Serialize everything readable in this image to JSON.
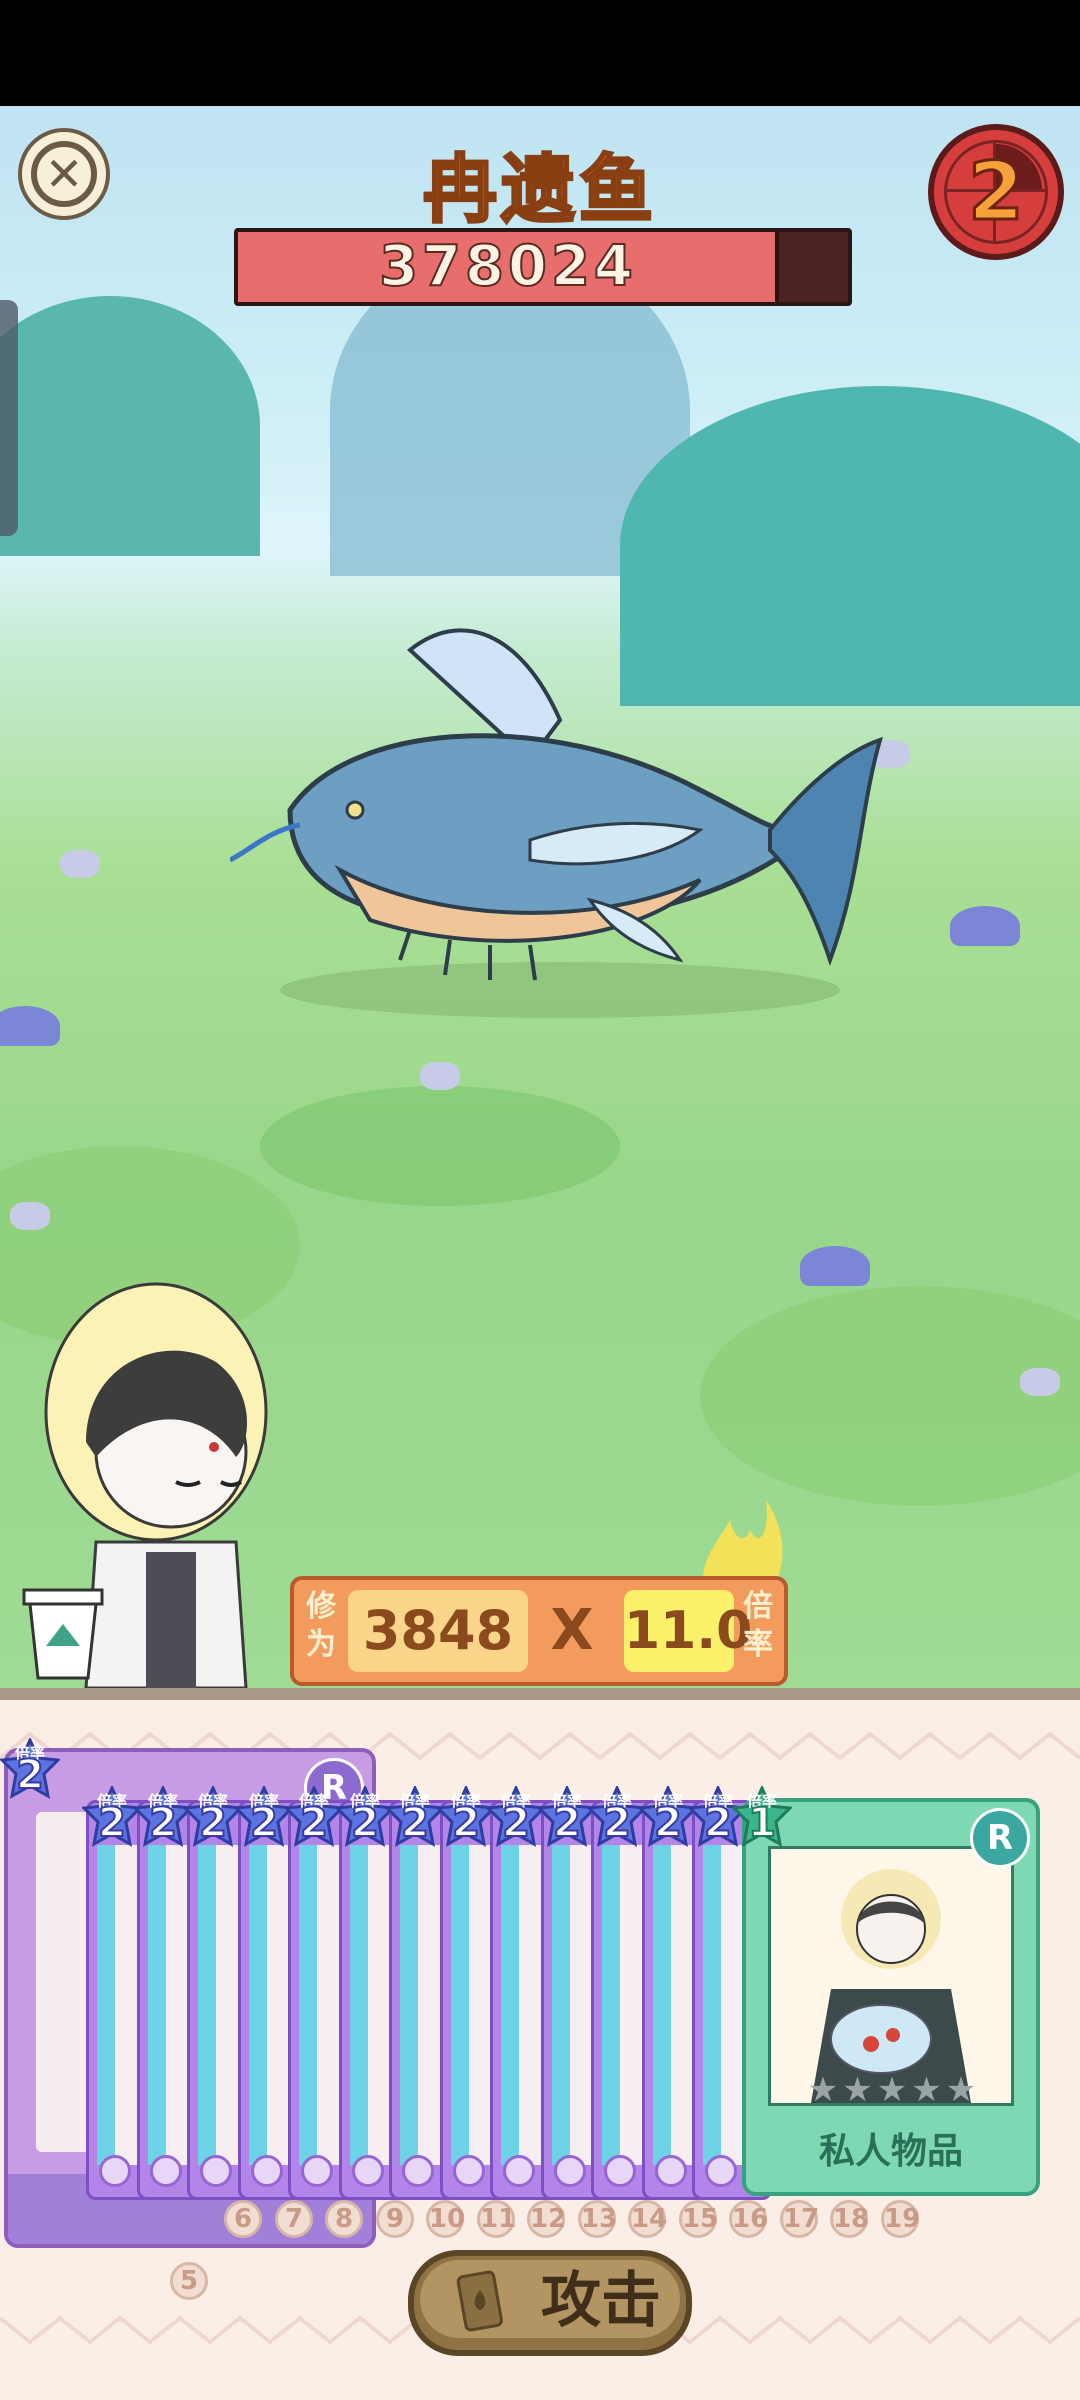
{
  "header": {
    "enemy_name": "冉遗鱼",
    "hp_value": "378024",
    "hp_fraction": 0.88,
    "round_number": "2"
  },
  "cultivation": {
    "label": "修为",
    "value": "3848",
    "multiply_sign": "X",
    "rate": "11.0",
    "rate_label": "倍率"
  },
  "hand": {
    "rate_label": "倍率",
    "big_card_rate": "2",
    "mini_card_rates": [
      "2",
      "2",
      "2",
      "2",
      "2",
      "2",
      "2",
      "2",
      "2",
      "2",
      "2",
      "2",
      "2"
    ],
    "green_card": {
      "rate": "1",
      "rarity": "R",
      "name": "私人物品",
      "stars": "★★★★★",
      "star_count": 0
    },
    "big_card_rarity": "R",
    "card_numbers": [
      "6",
      "7",
      "8",
      "9",
      "10",
      "11",
      "12",
      "13",
      "14",
      "15",
      "16",
      "17",
      "18",
      "19"
    ],
    "extra_number": "5"
  },
  "attack_button": {
    "label": "攻击"
  },
  "colors": {
    "hp_fill": "#e86d6d",
    "title_orange": "#f39a3a",
    "card_purple": "#b385e8",
    "card_green": "#7fd8b4"
  }
}
